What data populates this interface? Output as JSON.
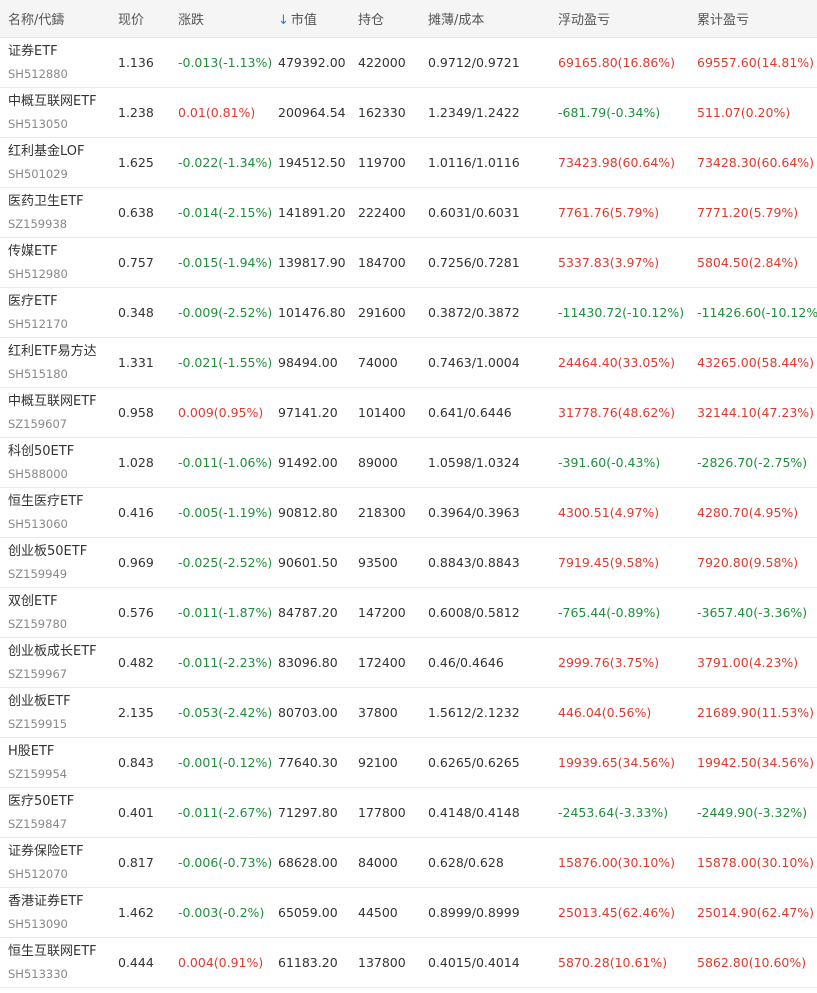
{
  "colors": {
    "up": "#e03a2e",
    "down": "#1f8f3c",
    "sort_arrow": "#2a7ae2"
  },
  "header": {
    "name": "名称/代鑄",
    "price": "现价",
    "change": "涨跌",
    "sort_icon": "arrow-down",
    "market_value": "市值",
    "position": "持仓",
    "cost": "摊薄/成本",
    "float_pl": "浮动盈亏",
    "total_pl": "累计盈亏"
  },
  "rows": [
    {
      "name": "证券ETF",
      "code": "SH512880",
      "price": "1.136",
      "change": "-0.013(-1.13%)",
      "change_dir": "down",
      "mv": "479392.00",
      "pos": "422000",
      "cost": "0.9712/0.9721",
      "float": "69165.80(16.86%)",
      "float_dir": "up",
      "total": "69557.60(14.81%)",
      "total_dir": "up"
    },
    {
      "name": "中概互联网ETF",
      "code": "SH513050",
      "price": "1.238",
      "change": "0.01(0.81%)",
      "change_dir": "up",
      "mv": "200964.54",
      "pos": "162330",
      "cost": "1.2349/1.2422",
      "float": "-681.79(-0.34%)",
      "float_dir": "down",
      "total": "511.07(0.20%)",
      "total_dir": "up"
    },
    {
      "name": "红利基金LOF",
      "code": "SH501029",
      "price": "1.625",
      "change": "-0.022(-1.34%)",
      "change_dir": "down",
      "mv": "194512.50",
      "pos": "119700",
      "cost": "1.0116/1.0116",
      "float": "73423.98(60.64%)",
      "float_dir": "up",
      "total": "73428.30(60.64%)",
      "total_dir": "up"
    },
    {
      "name": "医药卫生ETF",
      "code": "SZ159938",
      "price": "0.638",
      "change": "-0.014(-2.15%)",
      "change_dir": "down",
      "mv": "141891.20",
      "pos": "222400",
      "cost": "0.6031/0.6031",
      "float": "7761.76(5.79%)",
      "float_dir": "up",
      "total": "7771.20(5.79%)",
      "total_dir": "up"
    },
    {
      "name": "传媒ETF",
      "code": "SH512980",
      "price": "0.757",
      "change": "-0.015(-1.94%)",
      "change_dir": "down",
      "mv": "139817.90",
      "pos": "184700",
      "cost": "0.7256/0.7281",
      "float": "5337.83(3.97%)",
      "float_dir": "up",
      "total": "5804.50(2.84%)",
      "total_dir": "up"
    },
    {
      "name": "医疗ETF",
      "code": "SH512170",
      "price": "0.348",
      "change": "-0.009(-2.52%)",
      "change_dir": "down",
      "mv": "101476.80",
      "pos": "291600",
      "cost": "0.3872/0.3872",
      "float": "-11430.72(-10.12%)",
      "float_dir": "down",
      "total": "-11426.60(-10.12%)",
      "total_dir": "down"
    },
    {
      "name": "红利ETF易方达",
      "code": "SH515180",
      "price": "1.331",
      "change": "-0.021(-1.55%)",
      "change_dir": "down",
      "mv": "98494.00",
      "pos": "74000",
      "cost": "0.7463/1.0004",
      "float": "24464.40(33.05%)",
      "float_dir": "up",
      "total": "43265.00(58.44%)",
      "total_dir": "up"
    },
    {
      "name": "中概互联网ETF",
      "code": "SZ159607",
      "price": "0.958",
      "change": "0.009(0.95%)",
      "change_dir": "up",
      "mv": "97141.20",
      "pos": "101400",
      "cost": "0.641/0.6446",
      "float": "31778.76(48.62%)",
      "float_dir": "up",
      "total": "32144.10(47.23%)",
      "total_dir": "up"
    },
    {
      "name": "科创50ETF",
      "code": "SH588000",
      "price": "1.028",
      "change": "-0.011(-1.06%)",
      "change_dir": "down",
      "mv": "91492.00",
      "pos": "89000",
      "cost": "1.0598/1.0324",
      "float": "-391.60(-0.43%)",
      "float_dir": "down",
      "total": "-2826.70(-2.75%)",
      "total_dir": "down"
    },
    {
      "name": "恒生医疗ETF",
      "code": "SH513060",
      "price": "0.416",
      "change": "-0.005(-1.19%)",
      "change_dir": "down",
      "mv": "90812.80",
      "pos": "218300",
      "cost": "0.3964/0.3963",
      "float": "4300.51(4.97%)",
      "float_dir": "up",
      "total": "4280.70(4.95%)",
      "total_dir": "up"
    },
    {
      "name": "创业板50ETF",
      "code": "SZ159949",
      "price": "0.969",
      "change": "-0.025(-2.52%)",
      "change_dir": "down",
      "mv": "90601.50",
      "pos": "93500",
      "cost": "0.8843/0.8843",
      "float": "7919.45(9.58%)",
      "float_dir": "up",
      "total": "7920.80(9.58%)",
      "total_dir": "up"
    },
    {
      "name": "双创ETF",
      "code": "SZ159780",
      "price": "0.576",
      "change": "-0.011(-1.87%)",
      "change_dir": "down",
      "mv": "84787.20",
      "pos": "147200",
      "cost": "0.6008/0.5812",
      "float": "-765.44(-0.89%)",
      "float_dir": "down",
      "total": "-3657.40(-3.36%)",
      "total_dir": "down"
    },
    {
      "name": "创业板成长ETF",
      "code": "SZ159967",
      "price": "0.482",
      "change": "-0.011(-2.23%)",
      "change_dir": "down",
      "mv": "83096.80",
      "pos": "172400",
      "cost": "0.46/0.4646",
      "float": "2999.76(3.75%)",
      "float_dir": "up",
      "total": "3791.00(4.23%)",
      "total_dir": "up"
    },
    {
      "name": "创业板ETF",
      "code": "SZ159915",
      "price": "2.135",
      "change": "-0.053(-2.42%)",
      "change_dir": "down",
      "mv": "80703.00",
      "pos": "37800",
      "cost": "1.5612/2.1232",
      "float": "446.04(0.56%)",
      "float_dir": "up",
      "total": "21689.90(11.53%)",
      "total_dir": "up"
    },
    {
      "name": "H股ETF",
      "code": "SZ159954",
      "price": "0.843",
      "change": "-0.001(-0.12%)",
      "change_dir": "down",
      "mv": "77640.30",
      "pos": "92100",
      "cost": "0.6265/0.6265",
      "float": "19939.65(34.56%)",
      "float_dir": "up",
      "total": "19942.50(34.56%)",
      "total_dir": "up"
    },
    {
      "name": "医疗50ETF",
      "code": "SZ159847",
      "price": "0.401",
      "change": "-0.011(-2.67%)",
      "change_dir": "down",
      "mv": "71297.80",
      "pos": "177800",
      "cost": "0.4148/0.4148",
      "float": "-2453.64(-3.33%)",
      "float_dir": "down",
      "total": "-2449.90(-3.32%)",
      "total_dir": "down"
    },
    {
      "name": "证券保险ETF",
      "code": "SH512070",
      "price": "0.817",
      "change": "-0.006(-0.73%)",
      "change_dir": "down",
      "mv": "68628.00",
      "pos": "84000",
      "cost": "0.628/0.628",
      "float": "15876.00(30.10%)",
      "float_dir": "up",
      "total": "15878.00(30.10%)",
      "total_dir": "up"
    },
    {
      "name": "香港证券ETF",
      "code": "SH513090",
      "price": "1.462",
      "change": "-0.003(-0.2%)",
      "change_dir": "down",
      "mv": "65059.00",
      "pos": "44500",
      "cost": "0.8999/0.8999",
      "float": "25013.45(62.46%)",
      "float_dir": "up",
      "total": "25014.90(62.47%)",
      "total_dir": "up"
    },
    {
      "name": "恒生互联网ETF",
      "code": "SH513330",
      "price": "0.444",
      "change": "0.004(0.91%)",
      "change_dir": "up",
      "mv": "61183.20",
      "pos": "137800",
      "cost": "0.4015/0.4014",
      "float": "5870.28(10.61%)",
      "float_dir": "up",
      "total": "5862.80(10.60%)",
      "total_dir": "up"
    }
  ]
}
